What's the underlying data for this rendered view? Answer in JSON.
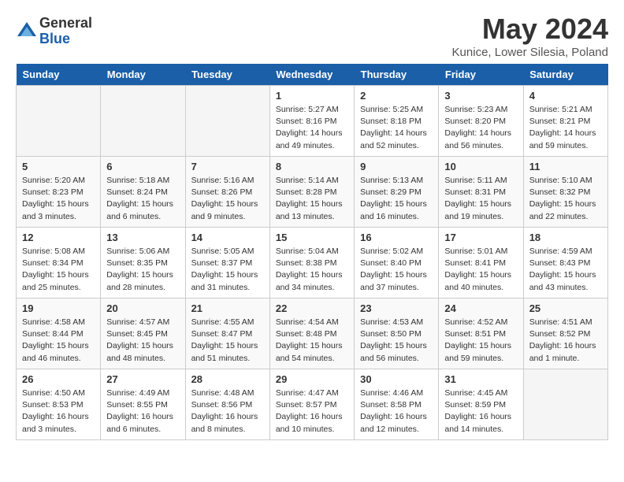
{
  "logo": {
    "general": "General",
    "blue": "Blue"
  },
  "header": {
    "month": "May 2024",
    "location": "Kunice, Lower Silesia, Poland"
  },
  "weekdays": [
    "Sunday",
    "Monday",
    "Tuesday",
    "Wednesday",
    "Thursday",
    "Friday",
    "Saturday"
  ],
  "weeks": [
    [
      {
        "day": "",
        "info": ""
      },
      {
        "day": "",
        "info": ""
      },
      {
        "day": "",
        "info": ""
      },
      {
        "day": "1",
        "info": "Sunrise: 5:27 AM\nSunset: 8:16 PM\nDaylight: 14 hours\nand 49 minutes."
      },
      {
        "day": "2",
        "info": "Sunrise: 5:25 AM\nSunset: 8:18 PM\nDaylight: 14 hours\nand 52 minutes."
      },
      {
        "day": "3",
        "info": "Sunrise: 5:23 AM\nSunset: 8:20 PM\nDaylight: 14 hours\nand 56 minutes."
      },
      {
        "day": "4",
        "info": "Sunrise: 5:21 AM\nSunset: 8:21 PM\nDaylight: 14 hours\nand 59 minutes."
      }
    ],
    [
      {
        "day": "5",
        "info": "Sunrise: 5:20 AM\nSunset: 8:23 PM\nDaylight: 15 hours\nand 3 minutes."
      },
      {
        "day": "6",
        "info": "Sunrise: 5:18 AM\nSunset: 8:24 PM\nDaylight: 15 hours\nand 6 minutes."
      },
      {
        "day": "7",
        "info": "Sunrise: 5:16 AM\nSunset: 8:26 PM\nDaylight: 15 hours\nand 9 minutes."
      },
      {
        "day": "8",
        "info": "Sunrise: 5:14 AM\nSunset: 8:28 PM\nDaylight: 15 hours\nand 13 minutes."
      },
      {
        "day": "9",
        "info": "Sunrise: 5:13 AM\nSunset: 8:29 PM\nDaylight: 15 hours\nand 16 minutes."
      },
      {
        "day": "10",
        "info": "Sunrise: 5:11 AM\nSunset: 8:31 PM\nDaylight: 15 hours\nand 19 minutes."
      },
      {
        "day": "11",
        "info": "Sunrise: 5:10 AM\nSunset: 8:32 PM\nDaylight: 15 hours\nand 22 minutes."
      }
    ],
    [
      {
        "day": "12",
        "info": "Sunrise: 5:08 AM\nSunset: 8:34 PM\nDaylight: 15 hours\nand 25 minutes."
      },
      {
        "day": "13",
        "info": "Sunrise: 5:06 AM\nSunset: 8:35 PM\nDaylight: 15 hours\nand 28 minutes."
      },
      {
        "day": "14",
        "info": "Sunrise: 5:05 AM\nSunset: 8:37 PM\nDaylight: 15 hours\nand 31 minutes."
      },
      {
        "day": "15",
        "info": "Sunrise: 5:04 AM\nSunset: 8:38 PM\nDaylight: 15 hours\nand 34 minutes."
      },
      {
        "day": "16",
        "info": "Sunrise: 5:02 AM\nSunset: 8:40 PM\nDaylight: 15 hours\nand 37 minutes."
      },
      {
        "day": "17",
        "info": "Sunrise: 5:01 AM\nSunset: 8:41 PM\nDaylight: 15 hours\nand 40 minutes."
      },
      {
        "day": "18",
        "info": "Sunrise: 4:59 AM\nSunset: 8:43 PM\nDaylight: 15 hours\nand 43 minutes."
      }
    ],
    [
      {
        "day": "19",
        "info": "Sunrise: 4:58 AM\nSunset: 8:44 PM\nDaylight: 15 hours\nand 46 minutes."
      },
      {
        "day": "20",
        "info": "Sunrise: 4:57 AM\nSunset: 8:45 PM\nDaylight: 15 hours\nand 48 minutes."
      },
      {
        "day": "21",
        "info": "Sunrise: 4:55 AM\nSunset: 8:47 PM\nDaylight: 15 hours\nand 51 minutes."
      },
      {
        "day": "22",
        "info": "Sunrise: 4:54 AM\nSunset: 8:48 PM\nDaylight: 15 hours\nand 54 minutes."
      },
      {
        "day": "23",
        "info": "Sunrise: 4:53 AM\nSunset: 8:50 PM\nDaylight: 15 hours\nand 56 minutes."
      },
      {
        "day": "24",
        "info": "Sunrise: 4:52 AM\nSunset: 8:51 PM\nDaylight: 15 hours\nand 59 minutes."
      },
      {
        "day": "25",
        "info": "Sunrise: 4:51 AM\nSunset: 8:52 PM\nDaylight: 16 hours\nand 1 minute."
      }
    ],
    [
      {
        "day": "26",
        "info": "Sunrise: 4:50 AM\nSunset: 8:53 PM\nDaylight: 16 hours\nand 3 minutes."
      },
      {
        "day": "27",
        "info": "Sunrise: 4:49 AM\nSunset: 8:55 PM\nDaylight: 16 hours\nand 6 minutes."
      },
      {
        "day": "28",
        "info": "Sunrise: 4:48 AM\nSunset: 8:56 PM\nDaylight: 16 hours\nand 8 minutes."
      },
      {
        "day": "29",
        "info": "Sunrise: 4:47 AM\nSunset: 8:57 PM\nDaylight: 16 hours\nand 10 minutes."
      },
      {
        "day": "30",
        "info": "Sunrise: 4:46 AM\nSunset: 8:58 PM\nDaylight: 16 hours\nand 12 minutes."
      },
      {
        "day": "31",
        "info": "Sunrise: 4:45 AM\nSunset: 8:59 PM\nDaylight: 16 hours\nand 14 minutes."
      },
      {
        "day": "",
        "info": ""
      }
    ]
  ]
}
